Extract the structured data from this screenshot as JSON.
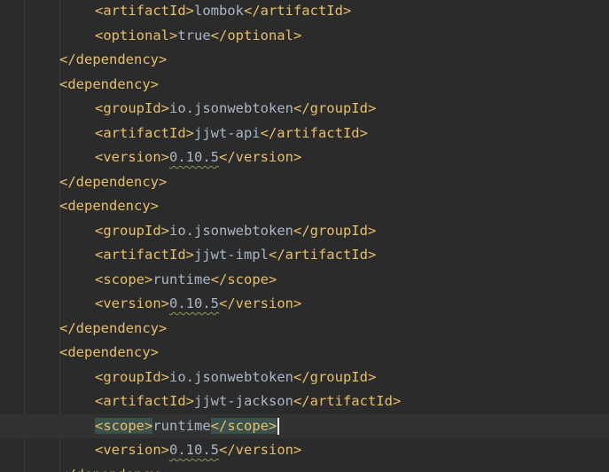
{
  "editor": {
    "lines": [
      {
        "indent": 2,
        "t1": "<artifactId>",
        "v": "lombok",
        "t2": "</artifactId>"
      },
      {
        "indent": 2,
        "t1": "<optional>",
        "v": "true",
        "t2": "</optional>"
      },
      {
        "indent": 1,
        "t1": "</dependency>",
        "v": "",
        "t2": ""
      },
      {
        "indent": 1,
        "t1": "<dependency>",
        "v": "",
        "t2": ""
      },
      {
        "indent": 2,
        "t1": "<groupId>",
        "v": "io.jsonwebtoken",
        "t2": "</groupId>"
      },
      {
        "indent": 2,
        "t1": "<artifactId>",
        "v": "jjwt-api",
        "t2": "</artifactId>"
      },
      {
        "indent": 2,
        "t1": "<version>",
        "v": "0.10.5",
        "t2": "</version>"
      },
      {
        "indent": 1,
        "t1": "</dependency>",
        "v": "",
        "t2": ""
      },
      {
        "indent": 1,
        "t1": "<dependency>",
        "v": "",
        "t2": ""
      },
      {
        "indent": 2,
        "t1": "<groupId>",
        "v": "io.jsonwebtoken",
        "t2": "</groupId>"
      },
      {
        "indent": 2,
        "t1": "<artifactId>",
        "v": "jjwt-impl",
        "t2": "</artifactId>"
      },
      {
        "indent": 2,
        "t1": "<scope>",
        "v": "runtime",
        "t2": "</scope>"
      },
      {
        "indent": 2,
        "t1": "<version>",
        "v": "0.10.5",
        "t2": "</version>"
      },
      {
        "indent": 1,
        "t1": "</dependency>",
        "v": "",
        "t2": ""
      },
      {
        "indent": 1,
        "t1": "<dependency>",
        "v": "",
        "t2": ""
      },
      {
        "indent": 2,
        "t1": "<groupId>",
        "v": "io.jsonwebtoken",
        "t2": "</groupId>"
      },
      {
        "indent": 2,
        "t1": "<artifactId>",
        "v": "jjwt-jackson",
        "t2": "</artifactId>"
      },
      {
        "indent": 2,
        "t1": "<scope>",
        "v": "runtime",
        "t2": "</scope>",
        "current": true,
        "highlight": true
      },
      {
        "indent": 2,
        "t1": "<version>",
        "v": "0.10.5",
        "t2": "</version>"
      },
      {
        "indent": 1,
        "t1": "</dependency>",
        "v": "",
        "t2": ""
      }
    ],
    "theme": {
      "background": "#2b2b2b",
      "tag_color": "#e8bf6a",
      "text_color": "#a9b7c6",
      "current_line": "#323232",
      "match_highlight": "#3b514d"
    }
  }
}
